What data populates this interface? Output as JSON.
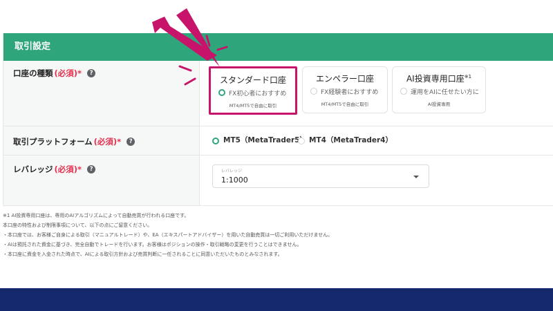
{
  "header": {
    "title": "取引設定"
  },
  "account_type": {
    "label": "口座の種類",
    "required": "(必須)*",
    "help_icon": "?",
    "options": [
      {
        "title": "スタンダード口座",
        "sup": "",
        "sub": "FX初心者におすすめ",
        "tag": "MT4/MT5で自由に取引",
        "selected": true
      },
      {
        "title": "エンペラー口座",
        "sup": "",
        "sub": "FX経験者におすすめ",
        "tag": "MT4/MT5で自由に取引",
        "selected": false
      },
      {
        "title": "AI投資専用口座",
        "sup": "※1",
        "sub": "運用をAIに任せたい方に",
        "tag": "AI投資専用",
        "selected": false
      }
    ]
  },
  "platform": {
    "label": "取引プラットフォーム",
    "required": "(必須)*",
    "help_icon": "?",
    "options": [
      {
        "label": "MT5（MetaTrader5）",
        "selected": true
      },
      {
        "label": "MT4（MetaTrader4）",
        "selected": false
      }
    ]
  },
  "leverage": {
    "label": "レバレッジ",
    "required": "(必須)*",
    "help_icon": "?",
    "caption": "レバレッジ",
    "value": "1:1000"
  },
  "notes": [
    "※1 AI投資専用口座は、専用のAIアルゴリズムによって自動売買が行われる口座です。",
    "本口座の特性および制限事項について、以下の点にご留意ください。",
    "・本口座では、お客様ご自身による取引（マニュアルトレード）や、EA（エキスパートアドバイザー）を用いた自動売買は一切ご利用いただけません。",
    "・AIは預託された資金に基づき、完全自動でトレードを行います。お客様はポジションの操作・取引戦略の変更を行うことはできません。",
    "・本口座に資金を入金された時点で、AIによる取引方針および売買判断に一任されることに同意いただいたものとみなされます。"
  ],
  "colors": {
    "accent": "#2fa57c",
    "required": "#e6304f",
    "highlight": "#c7136a",
    "footer": "#13296b"
  }
}
